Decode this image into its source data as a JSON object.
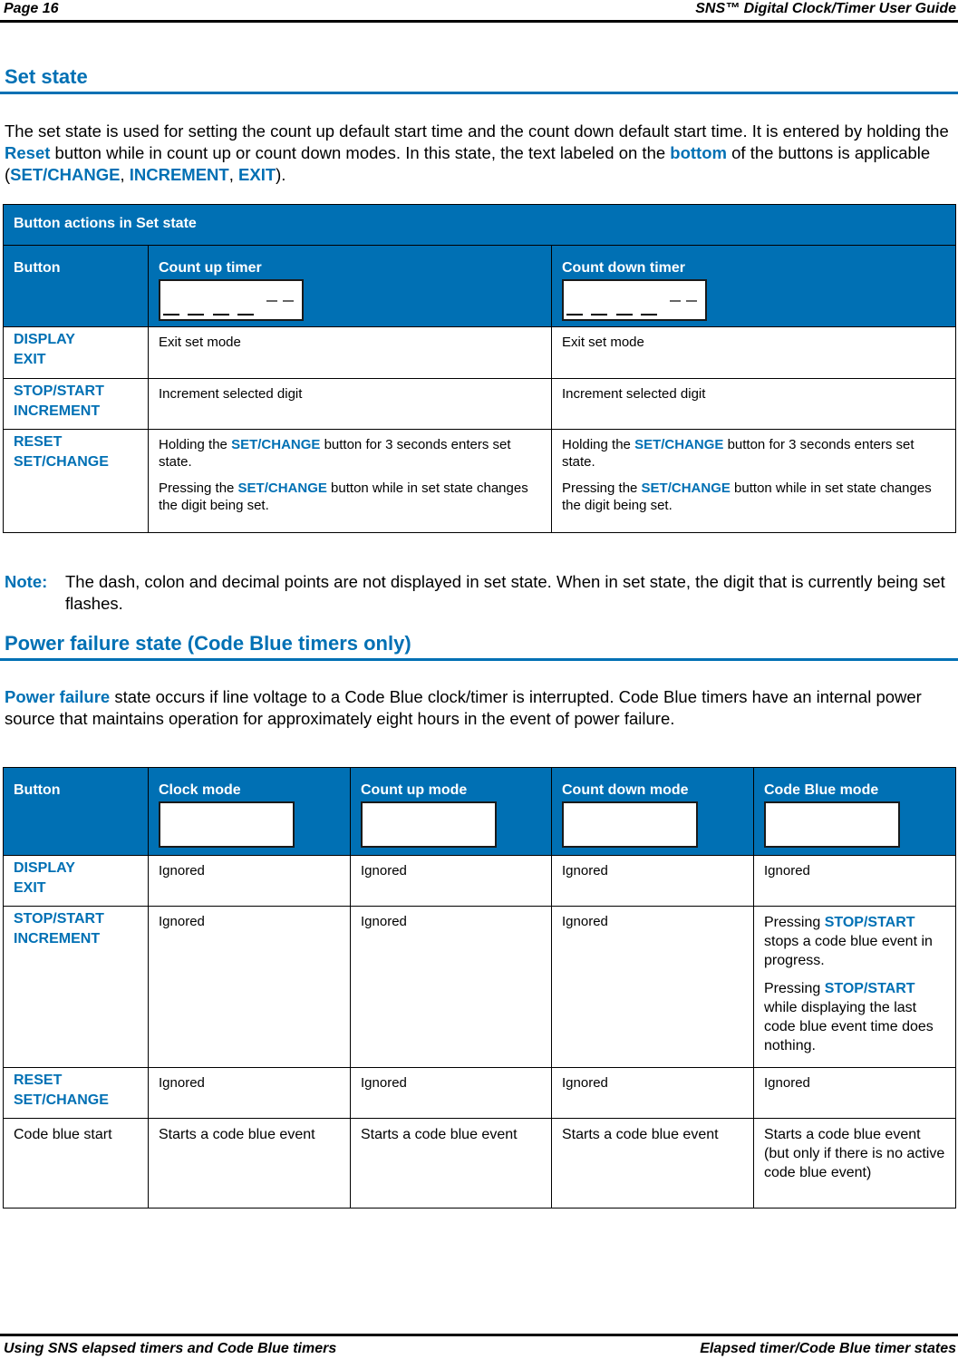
{
  "header": {
    "page": "Page 16",
    "guide_title": "SNS™ Digital Clock/Timer User Guide"
  },
  "set_state": {
    "heading": "Set state",
    "intro": {
      "p1": "The set state is used for setting the count up default start time and the count down default start time. It is entered by holding the ",
      "reset": "Reset",
      "p2": " button while in count up or count down modes. In this state, the text labeled on the ",
      "bottom": "bottom",
      "p3": " of the buttons is applicable (",
      "k1": "SET/CHANGE",
      "sep1": ", ",
      "k2": "INCREMENT",
      "sep2": ", ",
      "k3": "EXIT",
      "p4": ")."
    },
    "table": {
      "caption": "Button actions in Set state",
      "columns": [
        "Button",
        "Count up timer",
        "Count down timer"
      ],
      "rows": [
        {
          "button_line1": "DISPLAY",
          "button_line2": "EXIT",
          "count_up": "Exit set mode",
          "count_down": "Exit set mode"
        },
        {
          "button_line1": "STOP/START",
          "button_line2": "INCREMENT",
          "count_up": "Increment selected digit",
          "count_down": "Increment selected digit"
        },
        {
          "button_line1": "RESET",
          "button_line2": "SET/CHANGE",
          "count_up": {
            "a1": "Holding the ",
            "a_key": "SET/CHANGE",
            "a2": " button for 3 seconds enters set state.",
            "b1": "Pressing the ",
            "b_key": "SET/CHANGE",
            "b2": " button while in set state changes the digit being set."
          },
          "count_down": {
            "a1": "Holding the ",
            "a_key": "SET/CHANGE",
            "a2": " button for 3 seconds enters set state.",
            "b1": "Pressing the ",
            "b_key": "SET/CHANGE",
            "b2": " button while in set state changes the digit being set."
          }
        }
      ]
    }
  },
  "note": {
    "label": "Note:",
    "text": "The dash, colon and decimal points are not displayed in set state. When in set state, the digit that is currently being set flashes."
  },
  "power_failure": {
    "heading": "Power failure state (Code Blue timers only)",
    "intro": {
      "key": "Power failure",
      "text": " state occurs if line voltage to a Code Blue clock/timer is interrupted. Code Blue timers have an internal power source that maintains operation for approximately eight hours in the event of power failure."
    },
    "table": {
      "columns": [
        "Button",
        "Clock mode",
        "Count up mode",
        "Count down mode",
        "Code Blue mode"
      ],
      "rows": [
        {
          "button_line1": "DISPLAY",
          "button_line2": "EXIT",
          "cells": [
            "Ignored",
            "Ignored",
            "Ignored",
            "Ignored"
          ]
        },
        {
          "button_line1": "STOP/START",
          "button_line2": "INCREMENT",
          "cells": [
            "Ignored",
            "Ignored",
            "Ignored"
          ],
          "code_blue": {
            "a1": "Pressing ",
            "a_key": "STOP/START",
            "a2": " stops a code blue event in progress.",
            "b1": "Pressing ",
            "b_key": "STOP/START",
            "b2": " while displaying the last code blue event time does nothing."
          }
        },
        {
          "button_line1": "RESET",
          "button_line2": "SET/CHANGE",
          "cells": [
            "Ignored",
            "Ignored",
            "Ignored",
            "Ignored"
          ]
        },
        {
          "button_plain": "Code blue start",
          "cells": [
            "Starts a code blue event",
            "Starts a code blue event",
            "Starts a code blue event",
            "Starts a code blue event (but only if there is no active code blue event)"
          ]
        }
      ]
    }
  },
  "footer": {
    "left": "Using SNS elapsed timers and Code Blue timers",
    "right": "Elapsed timer/Code Blue timer states"
  }
}
